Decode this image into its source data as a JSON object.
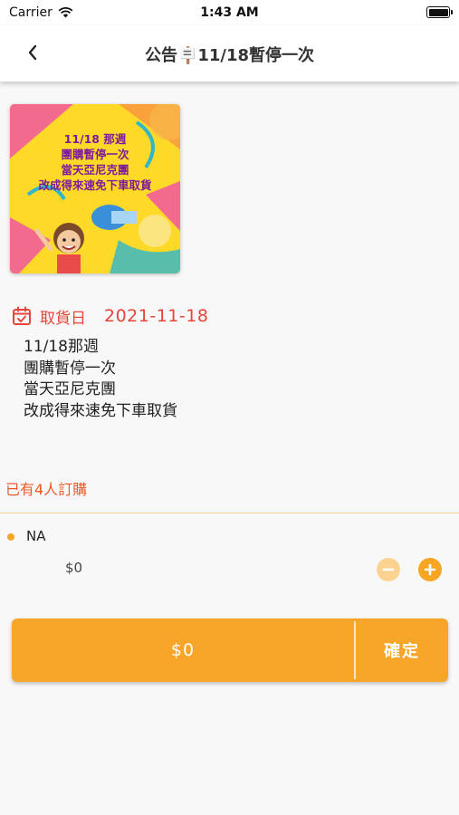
{
  "status_bar": {
    "carrier": "Carrier",
    "time": "1:43 AM"
  },
  "nav": {
    "title": "公告🪧11/18暫停一次",
    "back_icon": "chevron-left-icon"
  },
  "banner": {
    "lines": [
      "11/18 那週",
      "團購暫停一次",
      "當天亞尼克團",
      "改成得來速免下車取貨"
    ]
  },
  "pickup": {
    "label": "取貨日",
    "date": "2021-11-18",
    "icon": "calendar-check-icon",
    "color": "#e8443a"
  },
  "description": [
    "11/18那週",
    "團購暫停一次",
    "當天亞尼克團",
    "改成得來速免下車取貨"
  ],
  "subscribers_text": "已有4人訂購",
  "item": {
    "name": "NA",
    "price": "$0",
    "quantity_controls": {
      "minus_icon": "minus-circle-icon",
      "plus_icon": "plus-circle-icon"
    }
  },
  "footer": {
    "total": "$0",
    "confirm_label": "確定",
    "accent": "#f8a62a"
  }
}
